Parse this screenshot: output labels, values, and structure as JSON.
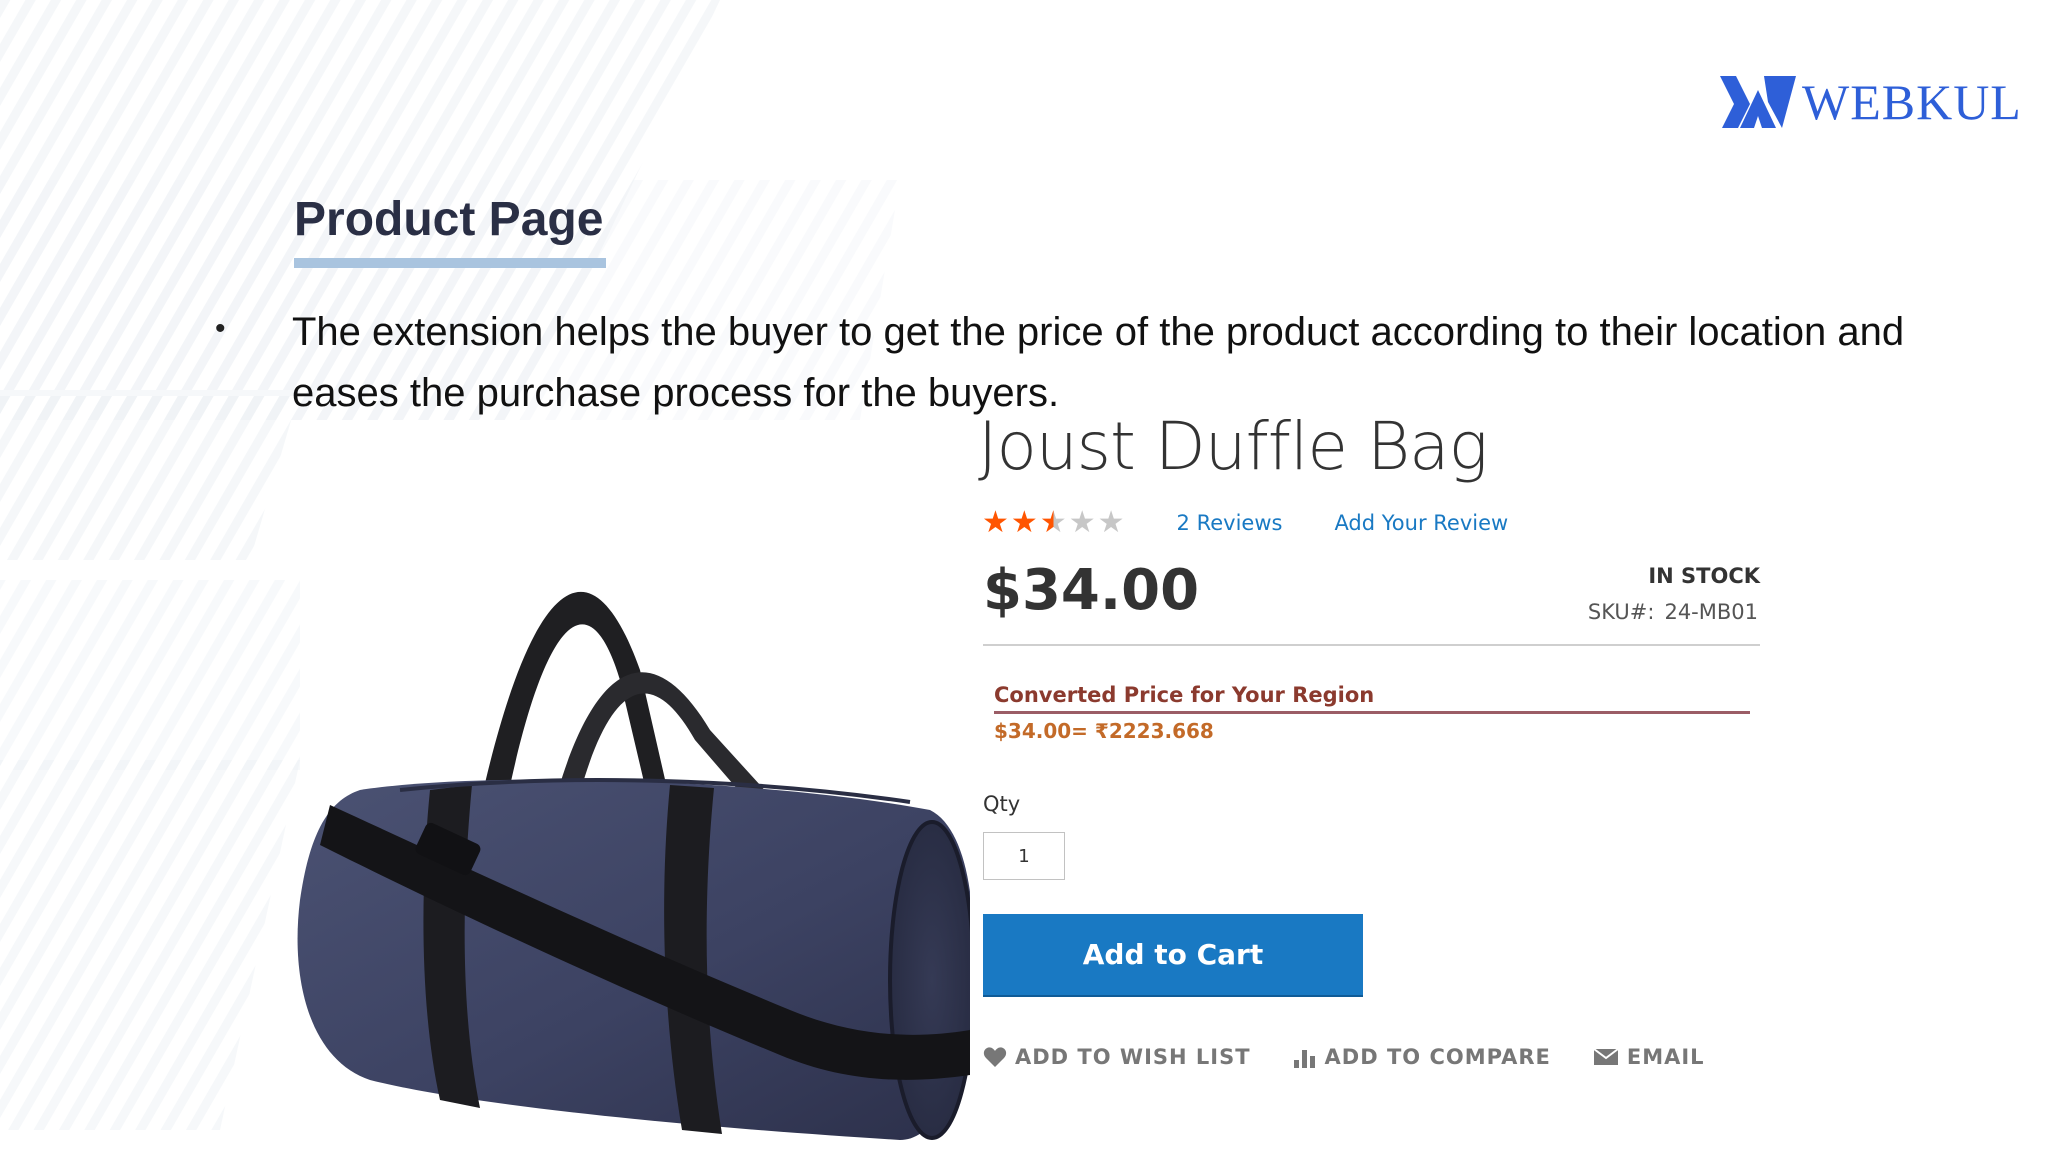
{
  "brand": {
    "logo_text": "WEBKUL",
    "color": "#2e5fd8"
  },
  "slide": {
    "title": "Product Page",
    "bullet": "The extension helps the buyer to get the price of the product according to their location and eases the purchase process for the buyers."
  },
  "product": {
    "name": "Joust Duffle Bag",
    "rating_stars": 2.5,
    "rating_max": 5,
    "reviews_link": "2 Reviews",
    "add_review_link": "Add Your Review",
    "price": "$34.00",
    "stock_status": "IN STOCK",
    "sku_label": "SKU#:",
    "sku_value": "24-MB01",
    "converted_title": "Converted Price for Your Region",
    "converted_value": "$34.00= ₹2223.668",
    "qty_label": "Qty",
    "qty_value": "1",
    "add_to_cart_label": "Add to Cart",
    "actions": {
      "wishlist": "ADD TO WISH LIST",
      "compare": "ADD TO COMPARE",
      "email": "EMAIL"
    }
  },
  "colors": {
    "accent_blue": "#1979c3",
    "star_filled": "#ff5501",
    "star_empty": "#c7c7c7",
    "converted_title": "#8b3a2e",
    "converted_value": "#c36a28"
  }
}
